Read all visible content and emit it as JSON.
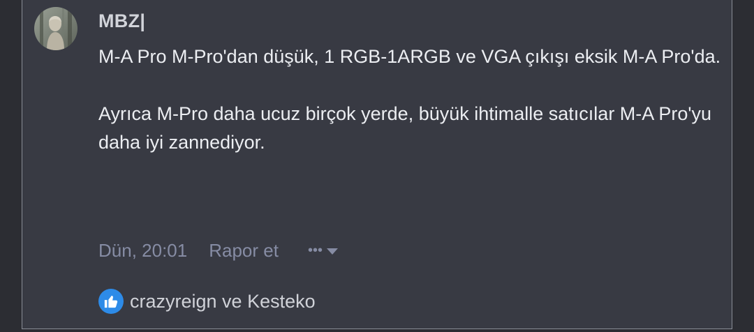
{
  "post": {
    "username": "MBZ|",
    "paragraphs": [
      "M-A Pro M-Pro'dan düşük, 1 RGB-1ARGB ve VGA çıkışı eksik M-A Pro'da.",
      "Ayrıca M-Pro daha ucuz birçok yerde, büyük ihtimalle satıcılar M-A Pro'yu daha iyi zannediyor."
    ],
    "date": "Dün, 20:01",
    "report_label": "Rapor et",
    "more_label": "•••",
    "reactions_text": "crazyreign ve Kesteko"
  },
  "icons": {
    "like": "thumbs-up-icon",
    "more": "chevron-down-icon"
  },
  "colors": {
    "background": "#2c2d33",
    "post_background": "#383a43",
    "meta_text": "#868ca4",
    "like_badge": "#2d8be8"
  }
}
